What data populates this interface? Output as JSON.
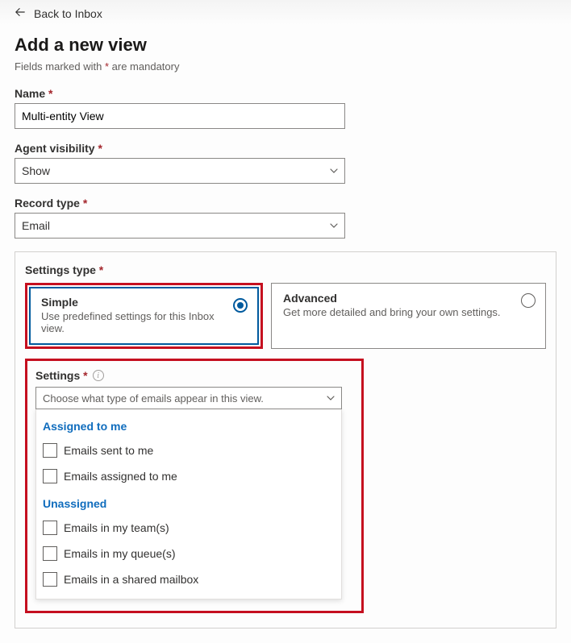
{
  "nav": {
    "back_label": "Back to Inbox"
  },
  "page": {
    "title": "Add a new view",
    "subtitle_prefix": "Fields marked with ",
    "subtitle_marker": "*",
    "subtitle_suffix": " are mandatory"
  },
  "fields": {
    "name": {
      "label": "Name",
      "value": "Multi-entity View"
    },
    "agent_visibility": {
      "label": "Agent visibility",
      "value": "Show"
    },
    "record_type": {
      "label": "Record type",
      "value": "Email"
    }
  },
  "settings_type": {
    "label": "Settings type",
    "options": [
      {
        "title": "Simple",
        "desc": "Use predefined settings for this Inbox view.",
        "selected": true
      },
      {
        "title": "Advanced",
        "desc": "Get more detailed and bring your own settings.",
        "selected": false
      }
    ]
  },
  "settings": {
    "label": "Settings",
    "placeholder": "Choose what type of emails appear in this view.",
    "groups": [
      {
        "header": "Assigned to me",
        "items": [
          "Emails sent to me",
          "Emails assigned to me"
        ]
      },
      {
        "header": "Unassigned",
        "items": [
          "Emails in my team(s)",
          "Emails in my queue(s)",
          "Emails in a shared mailbox"
        ]
      }
    ]
  }
}
